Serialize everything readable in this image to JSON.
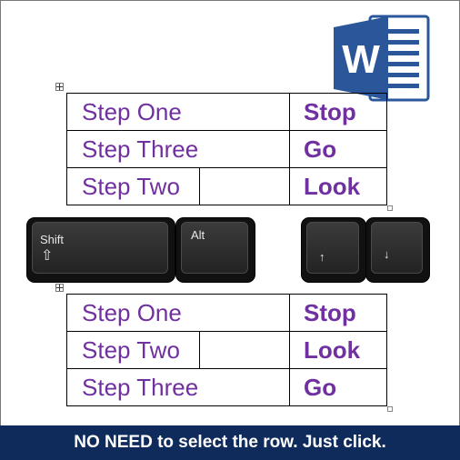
{
  "tables": [
    {
      "rows": [
        {
          "step": "Step One",
          "action": "Stop",
          "split": false
        },
        {
          "step": "Step Three",
          "action": "Go",
          "split": false
        },
        {
          "step": "Step Two",
          "action": "Look",
          "split": true
        }
      ]
    },
    {
      "rows": [
        {
          "step": "Step One",
          "action": "Stop",
          "split": false
        },
        {
          "step": "Step Two",
          "action": "Look",
          "split": true
        },
        {
          "step": "Step Three",
          "action": "Go",
          "split": false
        }
      ]
    }
  ],
  "keys": {
    "shift": "Shift",
    "shift_icon": "⇧",
    "alt": "Alt",
    "up": "↑",
    "down": "↓"
  },
  "logo": {
    "letter": "W",
    "icon": "microsoft-word-logo"
  },
  "banner": {
    "text": "NO NEED to select the row. Just click."
  },
  "colors": {
    "step_text": "#7030a0",
    "banner_bg": "#0f2b5c",
    "logo_blue": "#2b579a"
  }
}
